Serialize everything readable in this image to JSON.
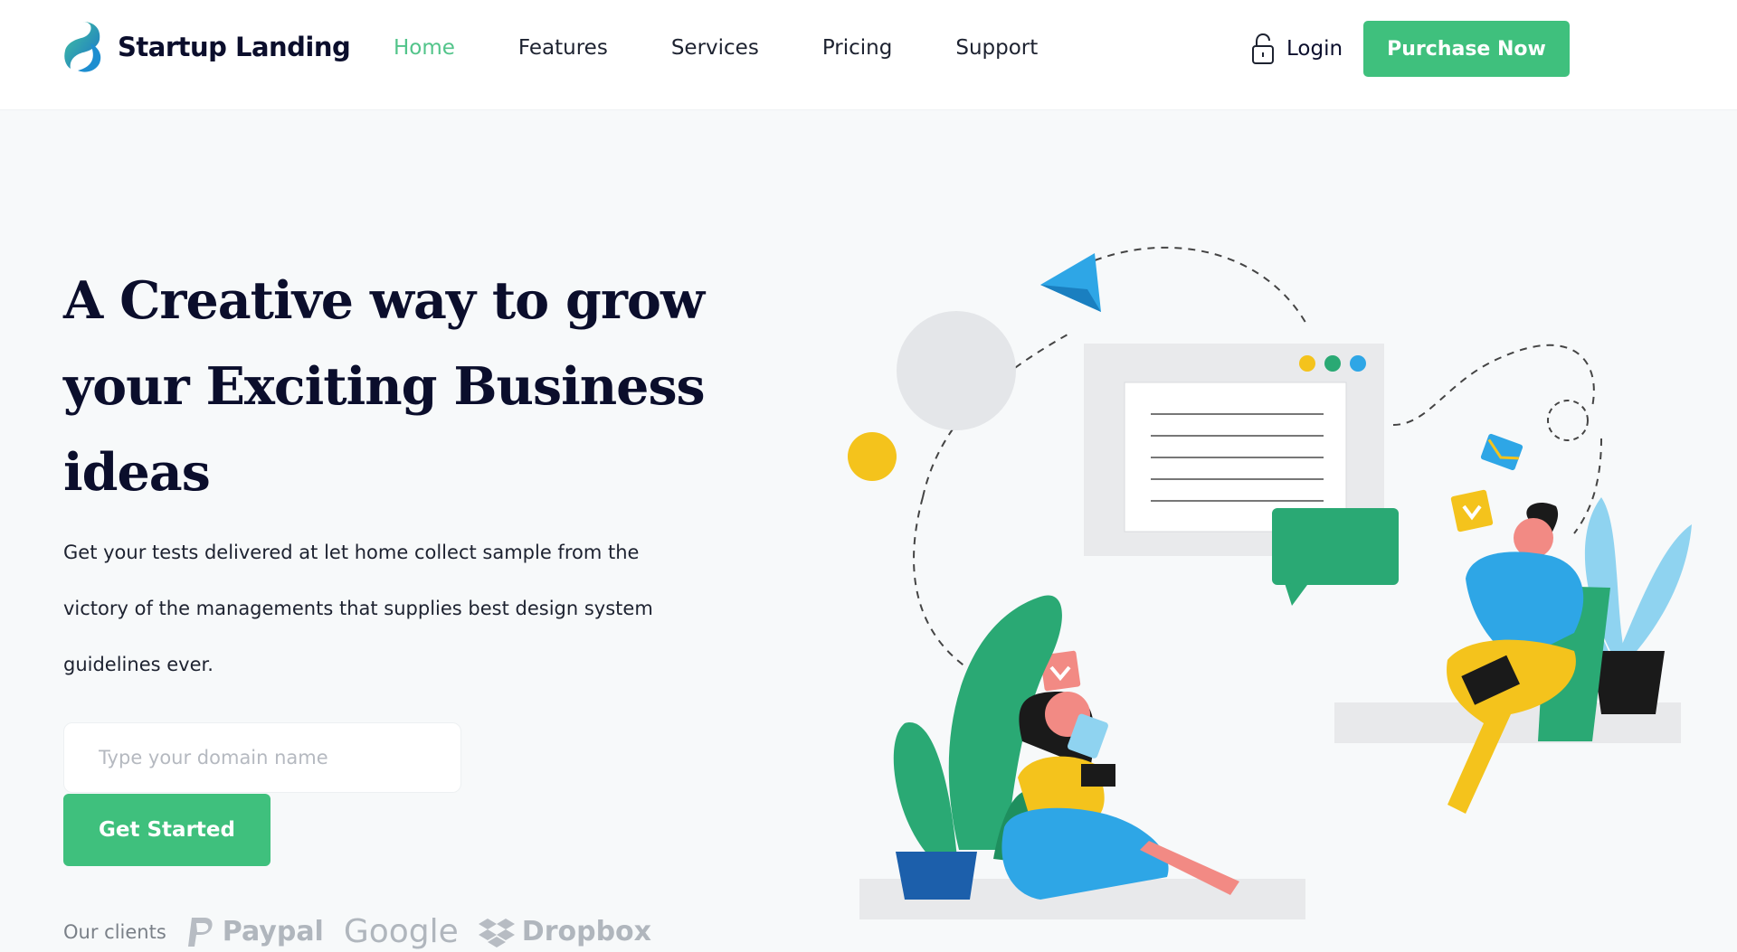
{
  "brand": {
    "name": "Startup Landing"
  },
  "nav": {
    "items": [
      {
        "label": "Home",
        "active": true
      },
      {
        "label": "Features"
      },
      {
        "label": "Services"
      },
      {
        "label": "Pricing"
      },
      {
        "label": "Support"
      }
    ]
  },
  "header": {
    "login_label": "Login",
    "purchase_label": "Purchase Now"
  },
  "hero": {
    "title": "A Creative way to grow your Exciting Business ideas",
    "description": "Get your tests delivered at let home collect sample from the victory of the managements that supplies best design system guidelines ever.",
    "input_placeholder": "Type your domain name",
    "cta_label": "Get Started"
  },
  "clients": {
    "label": "Our clients",
    "logos": [
      "Paypal",
      "Google",
      "Dropbox"
    ]
  },
  "colors": {
    "accent": "#3fc07d",
    "nav_active": "#52c48a",
    "heading": "#0b0e2c"
  }
}
